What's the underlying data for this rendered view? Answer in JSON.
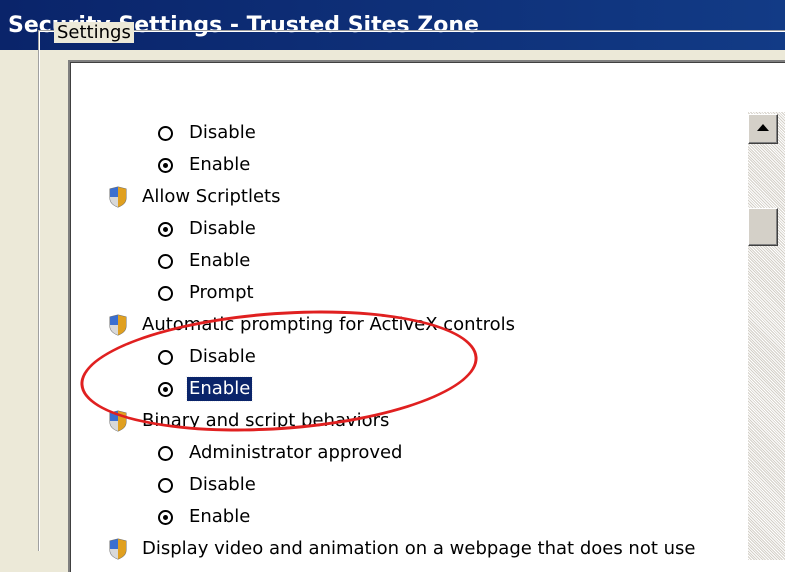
{
  "window": {
    "title": "Security Settings - Trusted Sites Zone"
  },
  "group": {
    "label": "Settings"
  },
  "settings_list": {
    "items": [
      {
        "type": "option",
        "label": "Disable",
        "checked": false
      },
      {
        "type": "option",
        "label": "Enable",
        "checked": true
      },
      {
        "type": "category",
        "label": "Allow Scriptlets",
        "icon": "security-shield-icon"
      },
      {
        "type": "option",
        "label": "Disable",
        "checked": true
      },
      {
        "type": "option",
        "label": "Enable",
        "checked": false
      },
      {
        "type": "option",
        "label": "Prompt",
        "checked": false
      },
      {
        "type": "category",
        "label": "Automatic prompting for ActiveX controls",
        "icon": "security-shield-icon"
      },
      {
        "type": "option",
        "label": "Disable",
        "checked": false
      },
      {
        "type": "option",
        "label": "Enable",
        "checked": true,
        "selected": true
      },
      {
        "type": "category",
        "label": "Binary and script behaviors",
        "icon": "security-shield-icon"
      },
      {
        "type": "option",
        "label": "Administrator approved",
        "checked": false
      },
      {
        "type": "option",
        "label": "Disable",
        "checked": false
      },
      {
        "type": "option",
        "label": "Enable",
        "checked": true
      },
      {
        "type": "category",
        "label": "Display video and animation on a webpage that does not use",
        "icon": "security-shield-icon"
      }
    ]
  },
  "scrollbar": {
    "up_icon": "scroll-up-arrow-icon"
  },
  "colors": {
    "titlebar": "#0a246a",
    "selection": "#0a246a",
    "annotation": "#e02020"
  }
}
